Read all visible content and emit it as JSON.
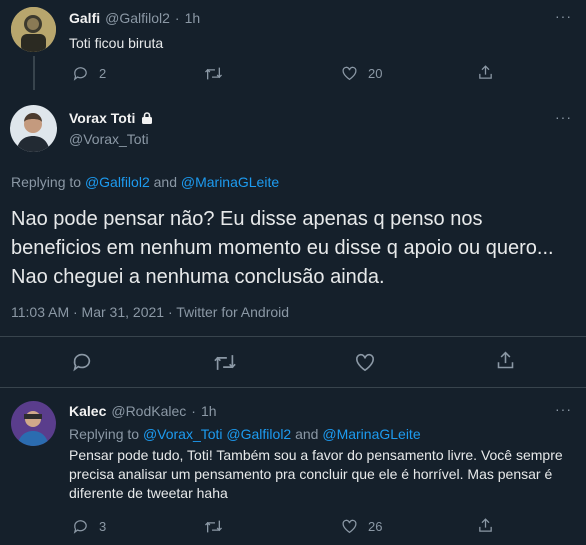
{
  "tweet1": {
    "name": "Galfi",
    "handle": "@Galfilol2",
    "time": "1h",
    "text": "Toti ficou biruta",
    "replies": "2",
    "retweets": "",
    "likes": "20",
    "more": "···"
  },
  "main": {
    "name": "Vorax Toti",
    "handle": "@Vorax_Toti",
    "replying_prefix": "Replying to",
    "replying_user1": "@Galfilol2",
    "replying_and": "and",
    "replying_user2": "@MarinaGLeite",
    "text": "Nao pode pensar não? Eu disse apenas q penso nos beneficios em nenhum momento eu disse q apoio ou quero... Nao cheguei a nenhuma conclusão ainda.",
    "meta": "11:03 AM · Mar 31, 2021 · Twitter for Android",
    "more": "···"
  },
  "reply": {
    "name": "Kalec",
    "handle": "@RodKalec",
    "time": "1h",
    "replying_prefix": "Replying to",
    "replying_user1": "@Vorax_Toti",
    "replying_user2": "@Galfilol2",
    "replying_and": "and",
    "replying_user3": "@MarinaGLeite",
    "text": "Pensar pode tudo, Toti! Também sou a favor do pensamento livre. Você sempre precisa analisar um pensamento pra concluir que ele é horrível. Mas pensar é diferente de tweetar haha",
    "replies": "3",
    "likes": "26",
    "more": "···"
  },
  "colors": {
    "background": "#15202b",
    "link": "#1d9bf0",
    "muted": "#8b98a5",
    "divider": "#38444d"
  }
}
